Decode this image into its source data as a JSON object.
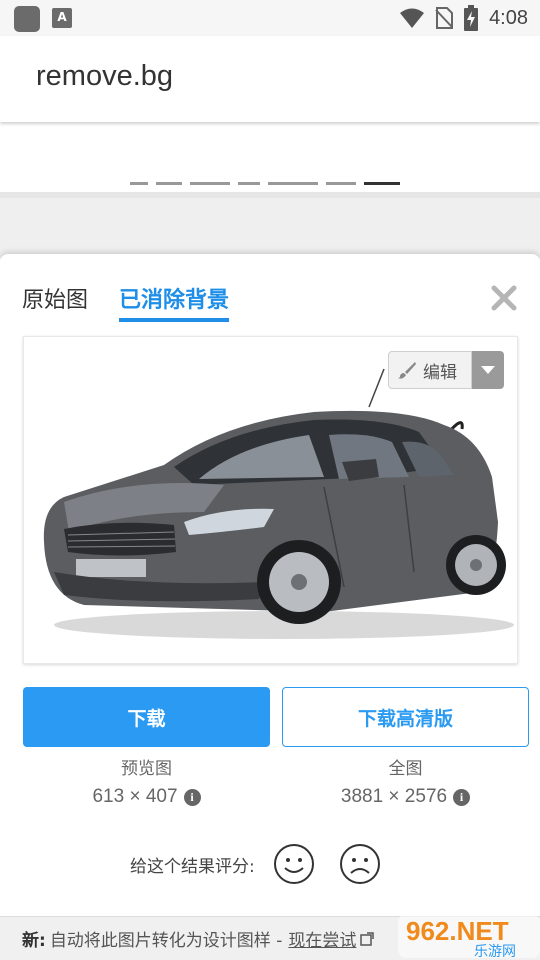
{
  "status_bar": {
    "time": "4:08"
  },
  "app_bar": {
    "title": "remove.bg"
  },
  "tabs": {
    "original": "原始图",
    "removed": "已消除背景"
  },
  "preview": {
    "edit_label": "编辑"
  },
  "actions": {
    "download": "下载",
    "download_hd": "下载高清版"
  },
  "preview_info": {
    "label": "预览图",
    "size": "613 × 407"
  },
  "full_info": {
    "label": "全图",
    "size": "3881 × 2576"
  },
  "rating": {
    "label": "给这个结果评分:"
  },
  "footer": {
    "prefix": "新:",
    "text": "自动将此图片转化为设计图样 -",
    "link": "现在尝试"
  },
  "watermark": {
    "brand": "962.NET",
    "sub": "乐游网"
  },
  "colors": {
    "accent": "#2a9af3",
    "tab_active": "#1e8ee8"
  },
  "icons": [
    "app-icon",
    "text-a-icon",
    "wifi-icon",
    "no-sim-icon",
    "battery-icon",
    "close-icon",
    "brush-icon",
    "dropdown-arrow-icon",
    "info-icon",
    "smile-icon",
    "frown-icon",
    "external-link-icon"
  ]
}
